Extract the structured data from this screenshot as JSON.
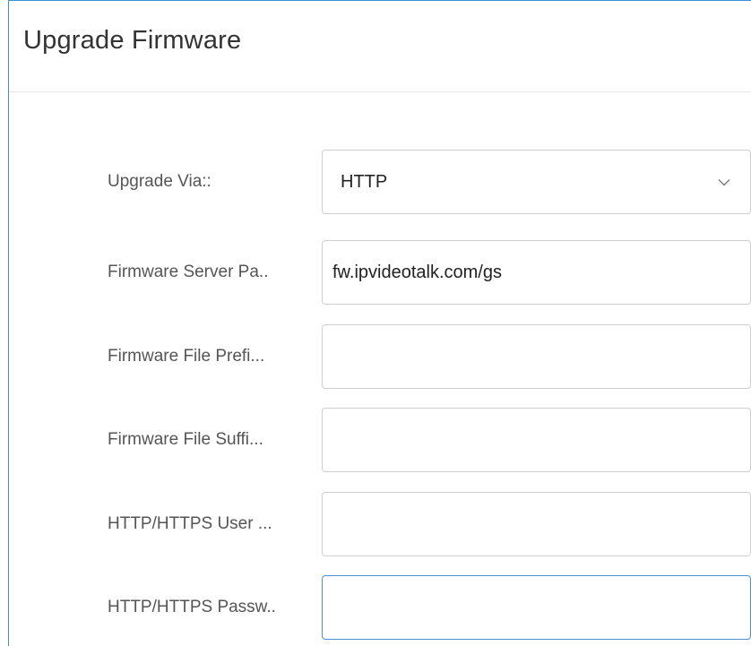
{
  "panel": {
    "title": "Upgrade Firmware"
  },
  "form": {
    "upgrade_via": {
      "label": "Upgrade Via::",
      "value": "HTTP"
    },
    "firmware_server_path": {
      "label": "Firmware Server Pa..",
      "value": "fw.ipvideotalk.com/gs"
    },
    "firmware_file_prefix": {
      "label": "Firmware File Prefi...",
      "value": ""
    },
    "firmware_file_suffix": {
      "label": "Firmware File Suffi...",
      "value": ""
    },
    "http_user": {
      "label": "HTTP/HTTPS User ...",
      "value": ""
    },
    "http_password": {
      "label": "HTTP/HTTPS Passw..",
      "value": ""
    }
  },
  "icons": {
    "select_chevron": "chevron-down-icon"
  },
  "colors": {
    "panel_border": "#3d8fd6",
    "focus_border": "#4a90e2",
    "field_border": "#cfcfcf"
  }
}
